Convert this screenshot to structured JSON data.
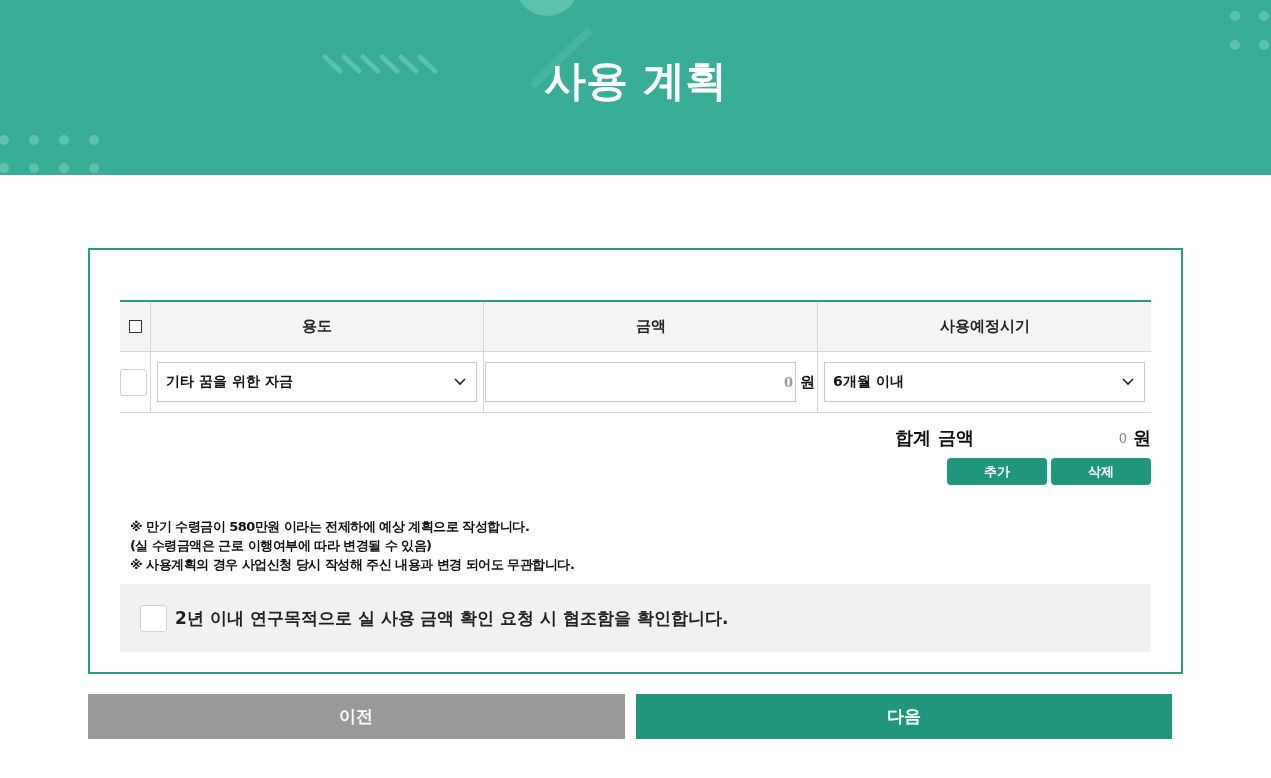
{
  "header": {
    "title": "사용 계획"
  },
  "table": {
    "select_all": {
      "checked": false
    },
    "columns": [
      "용도",
      "금액",
      "사용예정시기"
    ],
    "rows": [
      {
        "checked": false,
        "purpose": "기타 꿈을 위한 자금",
        "amount": "0",
        "unit": "원",
        "period": "6개월 이내"
      }
    ]
  },
  "total": {
    "label": "합계 금액",
    "value": "0",
    "unit": "원"
  },
  "row_buttons": [
    "추가",
    "삭제"
  ],
  "notes": [
    "※ 만기 수령금이 580만원 이라는 전제하에 예상 계획으로 작성합니다.",
    "(실 수령금액은 근로 이행여부에 따라 변경될 수 있음)",
    "※ 사용계획의 경우 사업신청 당시 작성해 주신 내용과 변경 되어도 무관합니다."
  ],
  "agreement": {
    "checked": false,
    "label": "2년 이내 연구목적으로 실 사용 금액 확인 요청 시 협조함을 확인합니다."
  },
  "nav_buttons": [
    {
      "kind": "prev",
      "label": "이전"
    },
    {
      "kind": "next",
      "label": "다음"
    }
  ]
}
